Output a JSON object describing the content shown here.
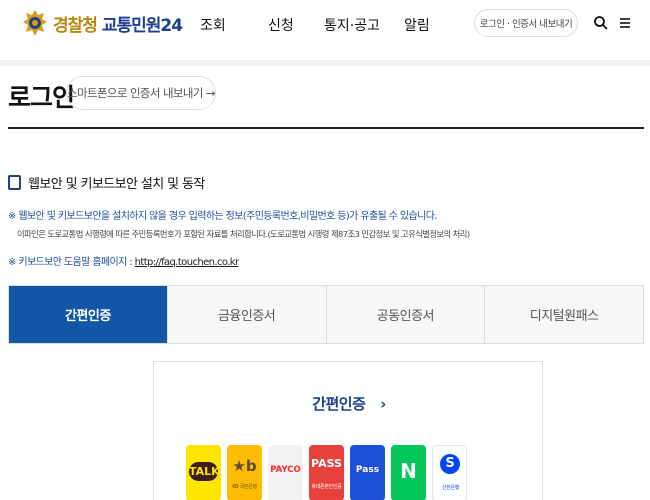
{
  "header": {
    "logo": {
      "part1": "경찰청",
      "part2": "교통민원24"
    },
    "nav": [
      "조회",
      "신청",
      "통지·공고",
      "알림"
    ],
    "login_button": "로그인 · 인증서 내보내기",
    "icons": [
      "search-icon",
      "menu-icon"
    ]
  },
  "page": {
    "title": "로그인",
    "export_button": "스마트폰으로 인증서 내보내기 →"
  },
  "security": {
    "checkbox_label": "웹보안 및 키보드보안 설치 및 동작",
    "checked": false,
    "notice_warning": "※ 웹보안 및 키보드보안을 설치하지 않을 경우 입력하는 정보(주민등록번호,비밀번호 등)가 유출될 수 있습니다.",
    "notice_detail": "이파인은 도로교통법 시행령에 따른 주민등록번호가 포함된 자료를 처리합니다.(도로교통법 시행령 제87조3 민감정보 및 고유식별정보의 처리)",
    "help_prefix": "※ 키보드보안 도움말 홈페이지 : ",
    "help_link": "http://faq.touchen.co.kr"
  },
  "tabs": [
    {
      "label": "간편인증",
      "active": true
    },
    {
      "label": "금융인증서",
      "active": false
    },
    {
      "label": "공동인증서",
      "active": false
    },
    {
      "label": "디지털원패스",
      "active": false
    }
  ],
  "simple_auth": {
    "title": "간편인증",
    "title_arrow": "›",
    "providers": [
      {
        "name": "kakaotalk",
        "text": "TALK",
        "sub": "",
        "bg": "#FEE500",
        "fg": "#3C1E1E"
      },
      {
        "name": "kb",
        "text": "★b",
        "sub": "KB 국민은행",
        "bg": "#FFBC00",
        "fg": "#5a4b3c"
      },
      {
        "name": "payco",
        "text": "PAYCO",
        "sub": "",
        "bg": "#F2F2F2",
        "fg": "#FA2828"
      },
      {
        "name": "pass",
        "text": "PASS",
        "sub": "휴대폰본인인증",
        "bg": "#E8413C",
        "fg": "#FFFFFF"
      },
      {
        "name": "samsung-pass",
        "text": "Pass",
        "sub": "",
        "bg": "#1E4FD8",
        "fg": "#FFFFFF"
      },
      {
        "name": "naver",
        "text": "N",
        "sub": "",
        "bg": "#03C75A",
        "fg": "#FFFFFF"
      },
      {
        "name": "shinhan",
        "text": "S",
        "sub": "신한은행",
        "bg": "#FFFFFF",
        "fg": "#0046FF"
      }
    ]
  }
}
